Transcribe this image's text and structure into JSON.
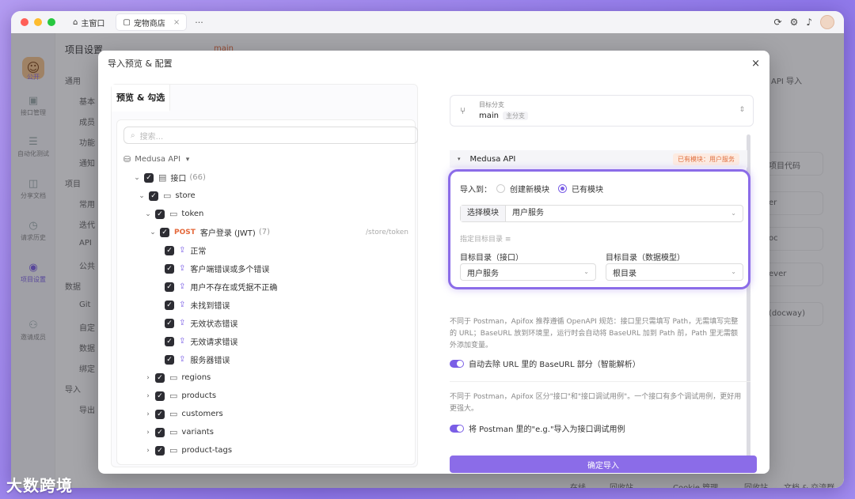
{
  "titlebar": {
    "tabs": [
      {
        "label": "主窗口"
      },
      {
        "label": "宠物商店"
      }
    ],
    "more": "···"
  },
  "leftnav": {
    "items": [
      {
        "label": "接口管理"
      },
      {
        "label": "自动化测试"
      },
      {
        "label": "分享文档"
      },
      {
        "label": "请求历史"
      },
      {
        "label": "项目设置"
      },
      {
        "label": "邀请成员"
      }
    ],
    "logo_text": "公开"
  },
  "background": {
    "title": "项目设置",
    "branch": "main",
    "api_import": "API 导入",
    "menu": [
      "通用",
      "基本",
      "成员",
      "功能",
      "通知",
      "项目",
      "常用",
      "迭代",
      "API",
      "公共",
      "数据",
      "Git",
      "自定",
      "数据",
      "绑定",
      "导入",
      "导出"
    ],
    "cards": [
      "项目代码",
      "er",
      "oc",
      "ever",
      "(docway)"
    ],
    "footer": [
      "在线",
      "回收站",
      "Cookie 管理",
      "回收站",
      "文档 & 交流群"
    ]
  },
  "dialog": {
    "title": "导入预览 & 配置",
    "close": "×",
    "left": {
      "tab": "预览 & 勾选",
      "search_placeholder": "搜索...",
      "root": "Medusa API",
      "tree": {
        "api_group": {
          "label": "接口",
          "count": "(66)"
        },
        "store": "store",
        "token": "token",
        "endpoint": {
          "method": "POST",
          "label": "客户登录 (JWT)",
          "count": "(7)",
          "path": "/store/token"
        },
        "cases": [
          "正常",
          "客户端错误或多个错误",
          "用户不存在或凭据不正确",
          "未找到错误",
          "无效状态错误",
          "无效请求错误",
          "服务器错误"
        ],
        "folders": [
          "regions",
          "products",
          "customers",
          "variants",
          "product-tags"
        ]
      }
    },
    "right": {
      "branch_label": "目标分支",
      "branch_name": "main",
      "branch_tag": "主分支",
      "project": "Medusa API",
      "exist_badge": "已有模块：用户服务",
      "import_to_label": "导入到：",
      "radio_new": "创建新模块",
      "radio_existing": "已有模块",
      "select_module_label": "选择模块",
      "select_module_value": "用户服务",
      "target_dir_hint": "指定目标目录 ≡",
      "target_api_label": "目标目录（接口）",
      "target_api_value": "用户服务",
      "target_model_label": "目标目录（数据模型）",
      "target_model_value": "根目录",
      "desc1": "不同于 Postman，Apifox 推荐遵循 OpenAPI 规范：接口里只需填写 Path，无需填写完整的 URL；BaseURL 放到环境里，运行时会自动将 BaseURL 加到 Path 前，Path 里无需额外添加变量。",
      "toggle1": "自动去除 URL 里的 BaseURL 部分（智能解析）",
      "desc2": "不同于 Postman，Apifox 区分\"接口\"和\"接口调试用例\"。一个接口有多个调试用例，更好用更强大。",
      "toggle2": "将 Postman 里的\"e.g.\"导入为接口调试用例",
      "confirm": "确定导入"
    }
  },
  "watermark": "大数跨境",
  "colors": {
    "accent": "#8b6ce8",
    "post": "#e4683a",
    "badge": "#e07040"
  }
}
